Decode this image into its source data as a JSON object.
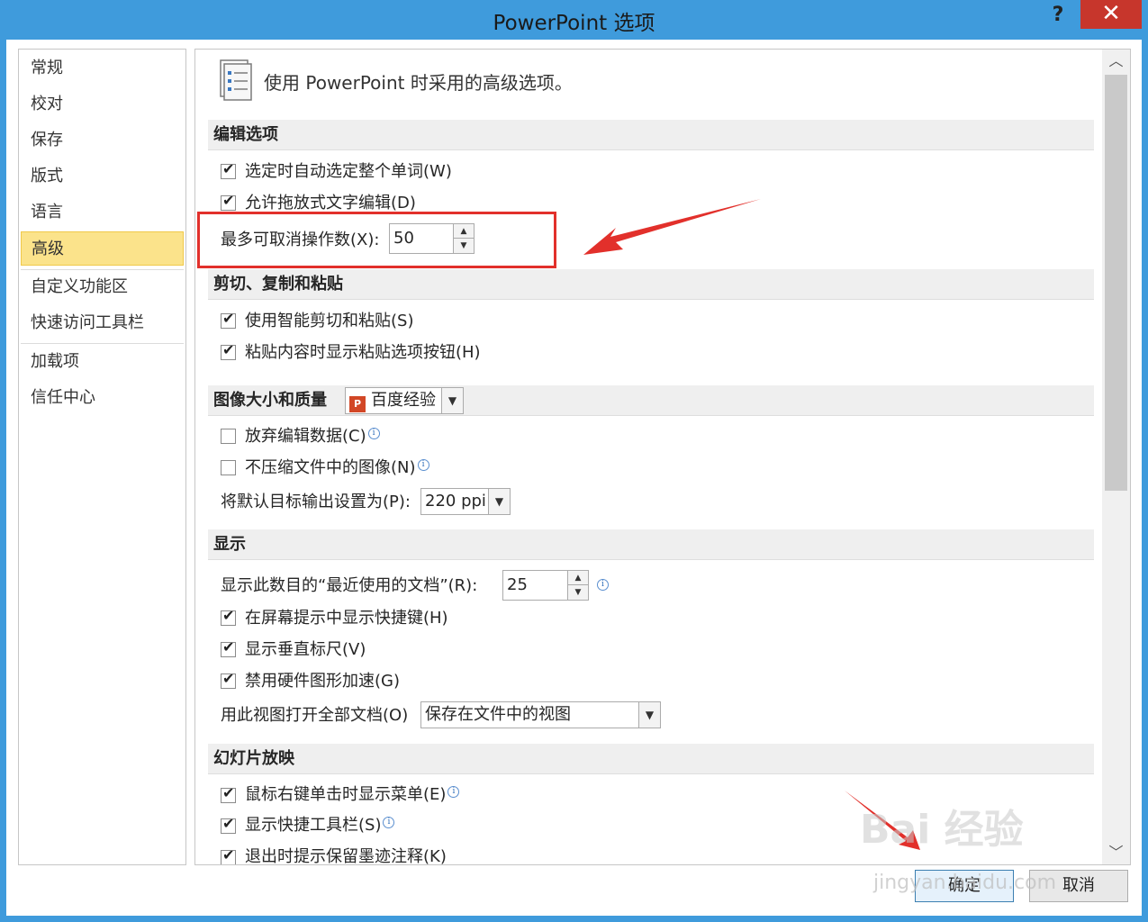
{
  "window": {
    "title": "PowerPoint 选项",
    "help_label": "?",
    "close_label": "✕"
  },
  "nav": {
    "items": [
      {
        "label": "常规"
      },
      {
        "label": "校对"
      },
      {
        "label": "保存"
      },
      {
        "label": "版式"
      },
      {
        "label": "语言"
      },
      {
        "label": "高级",
        "active": true
      },
      {
        "label": "自定义功能区"
      },
      {
        "label": "快速访问工具栏"
      },
      {
        "label": "加载项"
      },
      {
        "label": "信任中心"
      }
    ]
  },
  "panel": {
    "header": "使用 PowerPoint 时采用的高级选项。",
    "sections": {
      "editing": "编辑选项",
      "clipboard": "剪切、复制和粘贴",
      "image": "图像大小和质量",
      "display": "显示",
      "slideshow": "幻灯片放映"
    },
    "editing": {
      "select_word": "选定时自动选定整个单词(W)",
      "drag_drop": "允许拖放式文字编辑(D)",
      "undo_label": "最多可取消操作数(X):",
      "undo_value": "50"
    },
    "clipboard": {
      "smart_cut": "使用智能剪切和粘贴(S)",
      "paste_options": "粘贴内容时显示粘贴选项按钮(H)"
    },
    "image": {
      "file_value": "百度经验",
      "discard_edit": "放弃编辑数据(C)",
      "no_compress": "不压缩文件中的图像(N)",
      "output_label": "将默认目标输出设置为(P):",
      "output_value": "220 ppi"
    },
    "display": {
      "recent_label": "显示此数目的“最近使用的文档”(R):",
      "recent_value": "25",
      "shortcut_keys": "在屏幕提示中显示快捷键(H)",
      "vertical_ruler": "显示垂直标尺(V)",
      "disable_hw": "禁用硬件图形加速(G)",
      "open_view_label": "用此视图打开全部文档(O)",
      "open_view_value": "保存在文件中的视图"
    },
    "slideshow": {
      "right_click_menu": "鼠标右键单击时显示菜单(E)",
      "popup_toolbar": "显示快捷工具栏(S)",
      "prompt_ink": "退出时提示保留墨迹注释(K)"
    }
  },
  "buttons": {
    "ok": "确定",
    "cancel": "取消"
  },
  "watermark": {
    "text": "Bai 经验",
    "url": "jingyan.baidu.com"
  },
  "colors": {
    "titlebar": "#3f9bdc",
    "close": "#c7362c",
    "nav_active": "#fbe38b",
    "annotation_red": "#e2302b"
  }
}
